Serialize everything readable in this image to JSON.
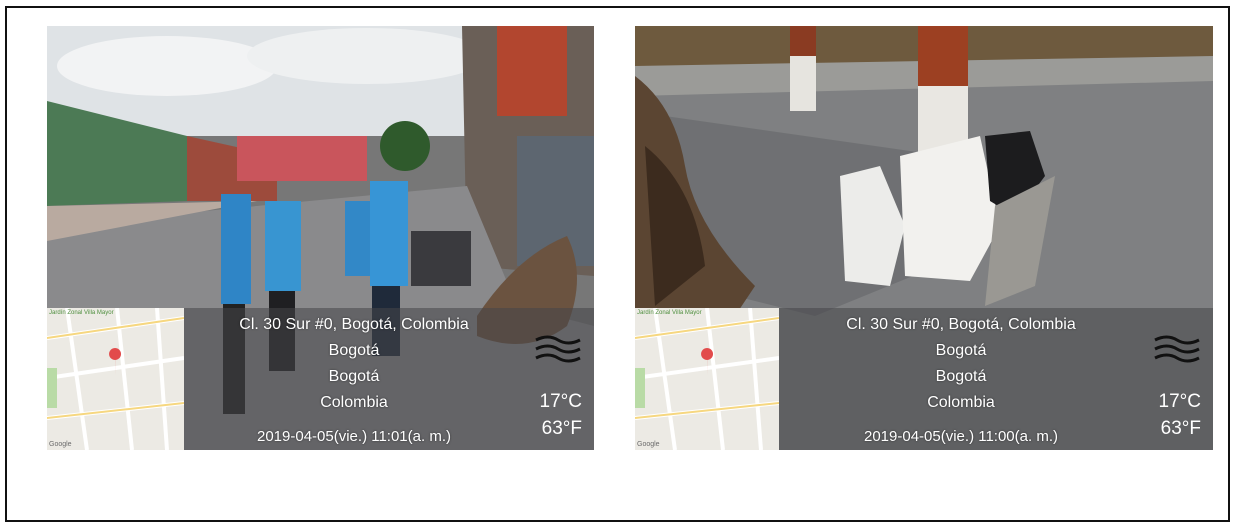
{
  "photos": [
    {
      "id": "left",
      "address": "Cl. 30 Sur #0, Bogotá, Colombia",
      "city": "Bogotá",
      "region": "Bogotá",
      "country": "Colombia",
      "temp_c": "17°C",
      "temp_f": "63°F",
      "datetime": "2019-04-05(vie.)  11:01(a. m.)",
      "weather_icon": "haze-icon",
      "map_labels": [
        "Jardín Zonal Villa Mayor",
        "Google"
      ]
    },
    {
      "id": "right",
      "address": "Cl. 30 Sur #0, Bogotá, Colombia",
      "city": "Bogotá",
      "region": "Bogotá",
      "country": "Colombia",
      "temp_c": "17°C",
      "temp_f": "63°F",
      "datetime": "2019-04-05(vie.)  11:00(a. m.)",
      "weather_icon": "haze-icon",
      "map_labels": [
        "Jardín Zonal Villa Mayor",
        "Google"
      ]
    }
  ],
  "colors": {
    "pin": "#e24b4b",
    "map_bg": "#eceae4",
    "overlay": "#464648"
  }
}
